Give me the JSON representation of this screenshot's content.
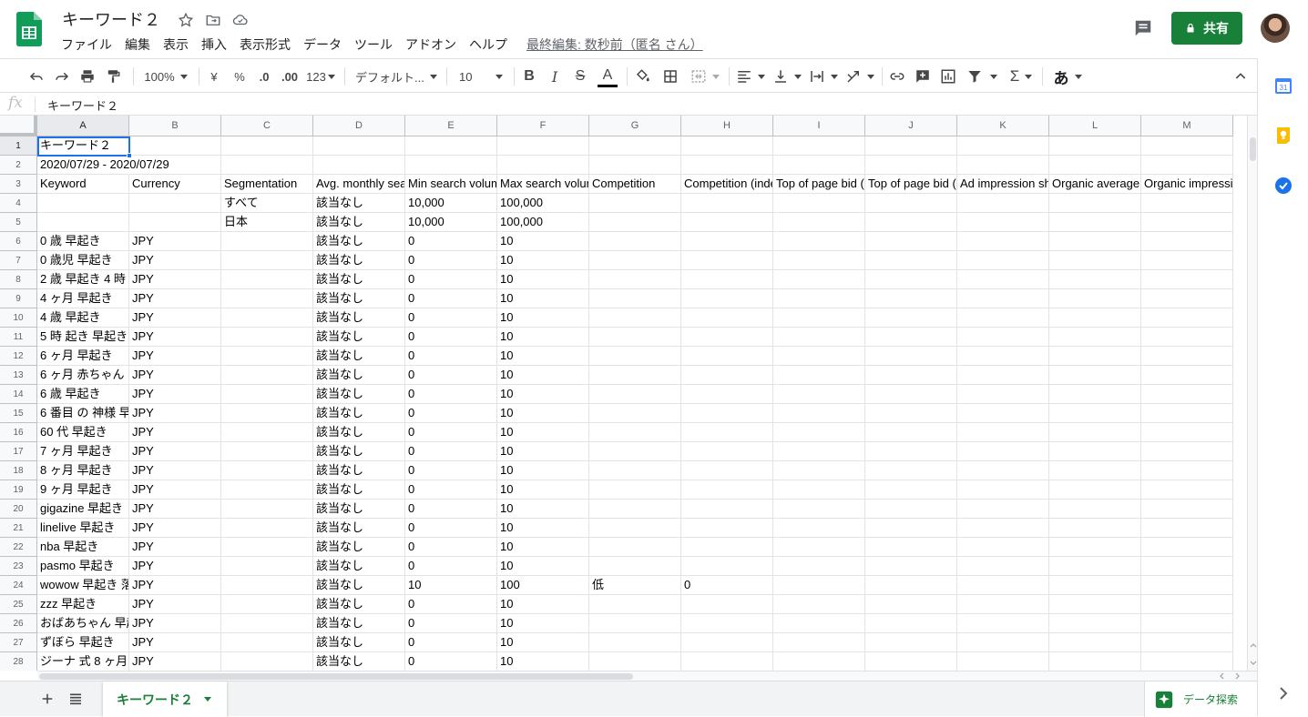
{
  "header": {
    "title": "キーワード２",
    "menus": [
      "ファイル",
      "編集",
      "表示",
      "挿入",
      "表示形式",
      "データ",
      "ツール",
      "アドオン",
      "ヘルプ"
    ],
    "last_edit": "最終編集: 数秒前（匿名 さん）",
    "share_label": "共有"
  },
  "toolbar": {
    "zoom": "100%",
    "currency": "¥",
    "percent": "%",
    "dec_decrease": ".0",
    "dec_increase": ".00",
    "more_formats": "123",
    "font": "デフォルト...",
    "font_size": "10",
    "bold": "B",
    "italic": "I",
    "strike": "S",
    "text_color": "A",
    "input_tool": "あ"
  },
  "formula_bar": {
    "fx": "fx",
    "value": "キーワード２"
  },
  "columns": [
    "A",
    "B",
    "C",
    "D",
    "E",
    "F",
    "G",
    "H",
    "I",
    "J",
    "K",
    "L",
    "M"
  ],
  "rows": [
    {
      "num": "1",
      "cells": [
        "キーワード２",
        "",
        "",
        "",
        "",
        "",
        "",
        "",
        "",
        "",
        "",
        "",
        ""
      ]
    },
    {
      "num": "2",
      "cells": [
        "2020/07/29 - 2020/07/29",
        "",
        "",
        "",
        "",
        "",
        "",
        "",
        "",
        "",
        "",
        "",
        ""
      ]
    },
    {
      "num": "3",
      "cells": [
        "Keyword",
        "Currency",
        "Segmentation",
        "Avg. monthly searches",
        "Min search volume",
        "Max search volume",
        "Competition",
        "Competition (indexed value)",
        "Top of page bid (low range)",
        "Top of page bid (high range)",
        "Ad impression share",
        "Organic average position",
        "Organic impression share"
      ]
    },
    {
      "num": "4",
      "cells": [
        "",
        "",
        "すべて",
        "該当なし",
        "10,000",
        "100,000",
        "",
        "",
        "",
        "",
        "",
        "",
        ""
      ]
    },
    {
      "num": "5",
      "cells": [
        "",
        "",
        "日本",
        "該当なし",
        "10,000",
        "100,000",
        "",
        "",
        "",
        "",
        "",
        "",
        ""
      ]
    },
    {
      "num": "6",
      "cells": [
        "0 歳 早起き",
        "JPY",
        "",
        "該当なし",
        "0",
        "10",
        "",
        "",
        "",
        "",
        "",
        "",
        ""
      ]
    },
    {
      "num": "7",
      "cells": [
        "0 歳児 早起き",
        "JPY",
        "",
        "該当なし",
        "0",
        "10",
        "",
        "",
        "",
        "",
        "",
        "",
        ""
      ]
    },
    {
      "num": "8",
      "cells": [
        "2 歳 早起き 4 時",
        "JPY",
        "",
        "該当なし",
        "0",
        "10",
        "",
        "",
        "",
        "",
        "",
        "",
        ""
      ]
    },
    {
      "num": "9",
      "cells": [
        "4 ヶ月 早起き",
        "JPY",
        "",
        "該当なし",
        "0",
        "10",
        "",
        "",
        "",
        "",
        "",
        "",
        ""
      ]
    },
    {
      "num": "10",
      "cells": [
        "4 歳 早起き",
        "JPY",
        "",
        "該当なし",
        "0",
        "10",
        "",
        "",
        "",
        "",
        "",
        "",
        ""
      ]
    },
    {
      "num": "11",
      "cells": [
        "5 時 起き 早起き",
        "JPY",
        "",
        "該当なし",
        "0",
        "10",
        "",
        "",
        "",
        "",
        "",
        "",
        ""
      ]
    },
    {
      "num": "12",
      "cells": [
        "6 ヶ月 早起き",
        "JPY",
        "",
        "該当なし",
        "0",
        "10",
        "",
        "",
        "",
        "",
        "",
        "",
        ""
      ]
    },
    {
      "num": "13",
      "cells": [
        "6 ヶ月 赤ちゃん",
        "JPY",
        "",
        "該当なし",
        "0",
        "10",
        "",
        "",
        "",
        "",
        "",
        "",
        ""
      ]
    },
    {
      "num": "14",
      "cells": [
        "6 歳 早起き",
        "JPY",
        "",
        "該当なし",
        "0",
        "10",
        "",
        "",
        "",
        "",
        "",
        "",
        ""
      ]
    },
    {
      "num": "15",
      "cells": [
        "6 番目 の 神様 早",
        "JPY",
        "",
        "該当なし",
        "0",
        "10",
        "",
        "",
        "",
        "",
        "",
        "",
        ""
      ]
    },
    {
      "num": "16",
      "cells": [
        "60 代 早起き",
        "JPY",
        "",
        "該当なし",
        "0",
        "10",
        "",
        "",
        "",
        "",
        "",
        "",
        ""
      ]
    },
    {
      "num": "17",
      "cells": [
        "7 ヶ月 早起き",
        "JPY",
        "",
        "該当なし",
        "0",
        "10",
        "",
        "",
        "",
        "",
        "",
        "",
        ""
      ]
    },
    {
      "num": "18",
      "cells": [
        "8 ヶ月 早起き",
        "JPY",
        "",
        "該当なし",
        "0",
        "10",
        "",
        "",
        "",
        "",
        "",
        "",
        ""
      ]
    },
    {
      "num": "19",
      "cells": [
        "9 ヶ月 早起き",
        "JPY",
        "",
        "該当なし",
        "0",
        "10",
        "",
        "",
        "",
        "",
        "",
        "",
        ""
      ]
    },
    {
      "num": "20",
      "cells": [
        "gigazine 早起き",
        "JPY",
        "",
        "該当なし",
        "0",
        "10",
        "",
        "",
        "",
        "",
        "",
        "",
        ""
      ]
    },
    {
      "num": "21",
      "cells": [
        "linelive 早起き",
        "JPY",
        "",
        "該当なし",
        "0",
        "10",
        "",
        "",
        "",
        "",
        "",
        "",
        ""
      ]
    },
    {
      "num": "22",
      "cells": [
        "nba 早起き",
        "JPY",
        "",
        "該当なし",
        "0",
        "10",
        "",
        "",
        "",
        "",
        "",
        "",
        ""
      ]
    },
    {
      "num": "23",
      "cells": [
        "pasmo 早起き",
        "JPY",
        "",
        "該当なし",
        "0",
        "10",
        "",
        "",
        "",
        "",
        "",
        "",
        ""
      ]
    },
    {
      "num": "24",
      "cells": [
        "wowow 早起き 落",
        "JPY",
        "",
        "該当なし",
        "10",
        "100",
        "低",
        "0",
        "",
        "",
        "",
        "",
        ""
      ]
    },
    {
      "num": "25",
      "cells": [
        "zzz 早起き",
        "JPY",
        "",
        "該当なし",
        "0",
        "10",
        "",
        "",
        "",
        "",
        "",
        "",
        ""
      ]
    },
    {
      "num": "26",
      "cells": [
        "おばあちゃん 早起",
        "JPY",
        "",
        "該当なし",
        "0",
        "10",
        "",
        "",
        "",
        "",
        "",
        "",
        ""
      ]
    },
    {
      "num": "27",
      "cells": [
        "ずぼら 早起き",
        "JPY",
        "",
        "該当なし",
        "0",
        "10",
        "",
        "",
        "",
        "",
        "",
        "",
        ""
      ]
    },
    {
      "num": "28",
      "cells": [
        "ジーナ 式 8 ヶ月",
        "JPY",
        "",
        "該当なし",
        "0",
        "10",
        "",
        "",
        "",
        "",
        "",
        "",
        ""
      ]
    }
  ],
  "sheet_tab": "キーワード２",
  "explore_label": "データ探索",
  "colors": {
    "green": "#188038",
    "selection": "#1a73e8"
  }
}
